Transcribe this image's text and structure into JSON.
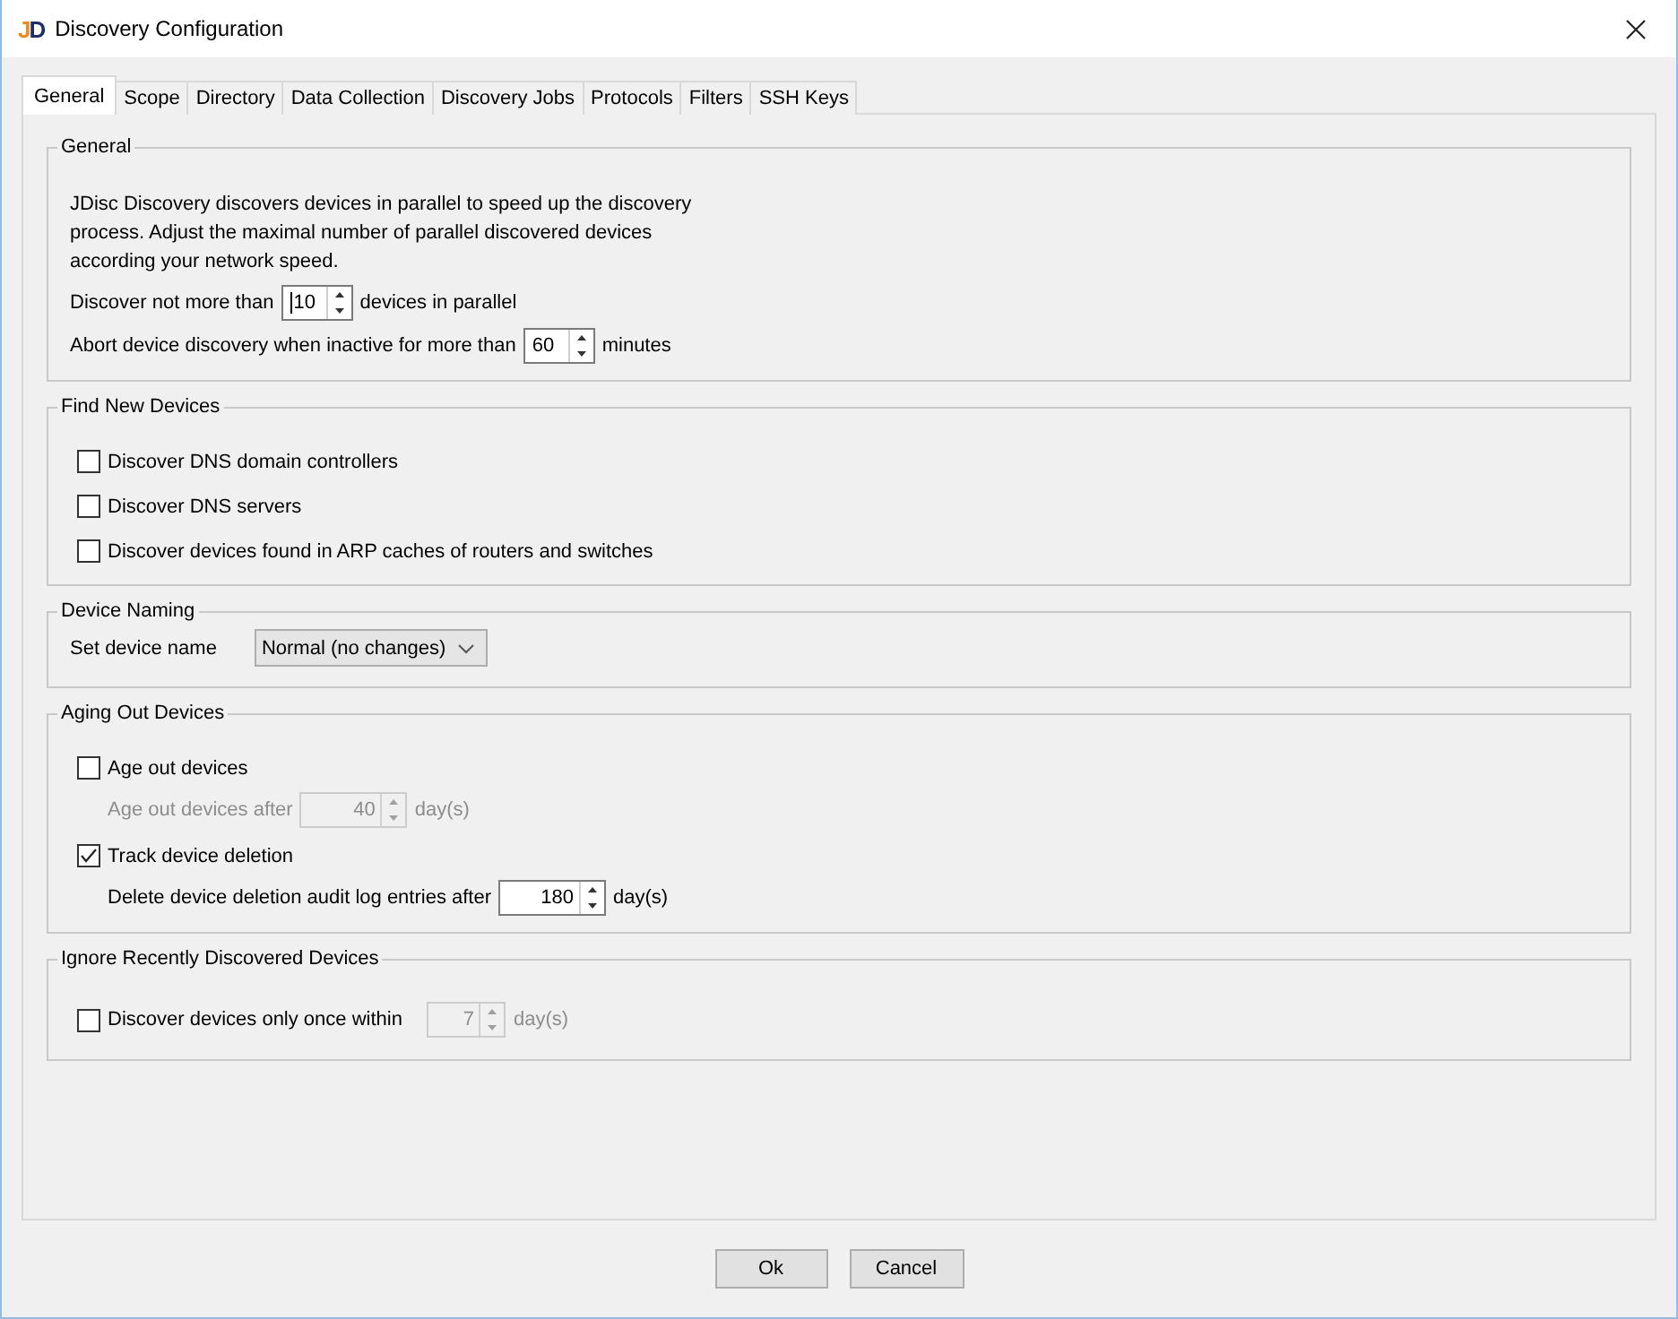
{
  "window": {
    "title": "Discovery Configuration",
    "logo": "JD"
  },
  "tabs": [
    {
      "label": "General",
      "selected": true
    },
    {
      "label": "Scope",
      "selected": false
    },
    {
      "label": "Directory",
      "selected": false
    },
    {
      "label": "Data Collection",
      "selected": false
    },
    {
      "label": "Discovery Jobs",
      "selected": false
    },
    {
      "label": "Protocols",
      "selected": false
    },
    {
      "label": "Filters",
      "selected": false
    },
    {
      "label": "SSH Keys",
      "selected": false
    }
  ],
  "sections": [
    {
      "title": "General",
      "rows": [
        {
          "kind": "text",
          "text": "JDisc Discovery discovers devices in parallel to speed up the discovery process. Adjust the maximal number of parallel discovered devices according your network speed."
        },
        {
          "kind": "spinner",
          "label": "Discover not more than",
          "value": "10",
          "suffix": "devices in parallel",
          "disabled": false,
          "focused": true
        },
        {
          "kind": "spinner",
          "label": "Abort device discovery when inactive for more than",
          "value": "60",
          "suffix": "minutes",
          "disabled": false,
          "focused": false
        }
      ]
    },
    {
      "title": "Find New Devices",
      "rows": [
        {
          "kind": "checkbox",
          "label": "Discover DNS domain controllers",
          "checked": false
        },
        {
          "kind": "checkbox",
          "label": "Discover DNS servers",
          "checked": false
        },
        {
          "kind": "checkbox",
          "label": "Discover devices found in ARP caches of routers and switches",
          "checked": false
        }
      ]
    },
    {
      "title": "Device Naming",
      "rows": [
        {
          "kind": "combo",
          "label": "Set device name",
          "value": "Normal (no changes)"
        }
      ]
    },
    {
      "title": "Aging Out Devices",
      "rows": [
        {
          "kind": "checkbox",
          "label": "Age out devices",
          "checked": false,
          "children": [
            {
              "kind": "spinner",
              "label": "Age out devices after",
              "value": "40",
              "suffix": "day(s)",
              "disabled": true,
              "focused": false
            }
          ]
        },
        {
          "kind": "checkbox",
          "label": "Track device deletion",
          "checked": true,
          "children": [
            {
              "kind": "spinner",
              "label": "Delete device deletion audit log entries after",
              "value": "180",
              "suffix": "day(s)",
              "disabled": false,
              "focused": false
            }
          ]
        }
      ]
    },
    {
      "title": "Ignore Recently Discovered Devices",
      "rows": [
        {
          "kind": "checkbox-spinner",
          "label": "Discover devices only once within",
          "checked": false,
          "value": "7",
          "suffix": "day(s)",
          "disabled": true
        }
      ]
    }
  ],
  "buttons": [
    "Ok",
    "Cancel"
  ]
}
